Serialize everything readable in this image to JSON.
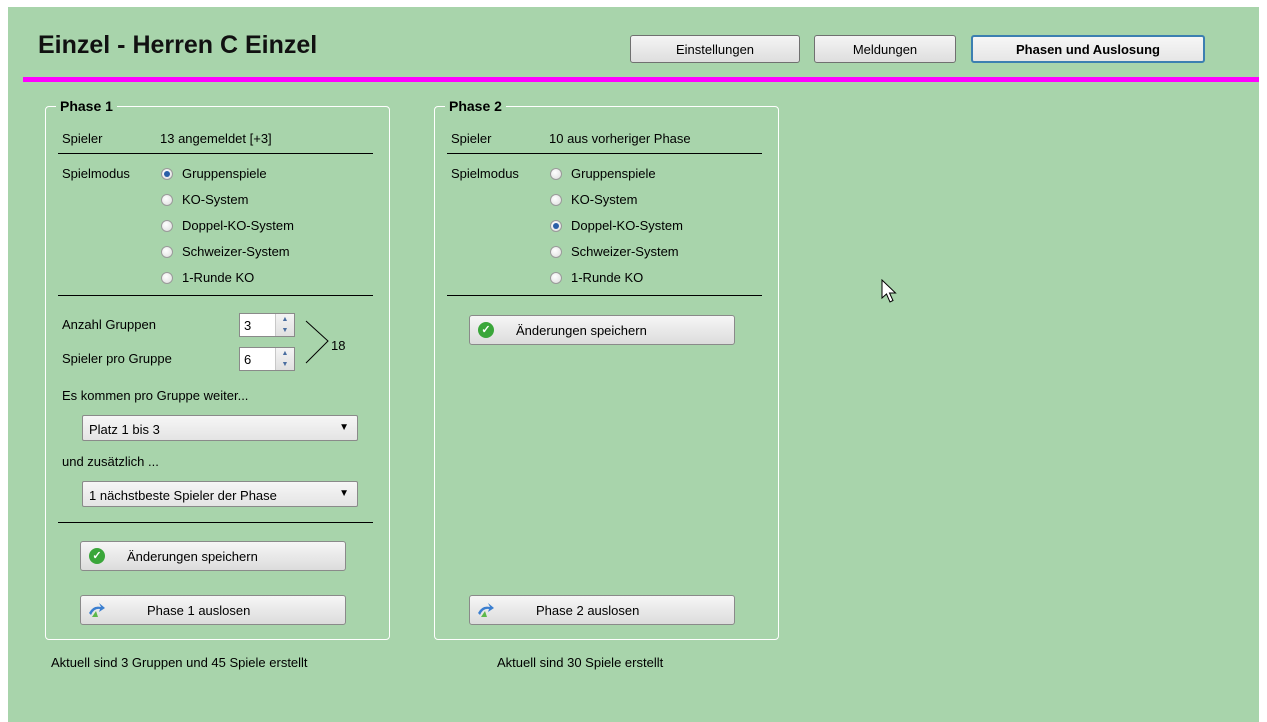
{
  "header": {
    "title": "Einzel - Herren C Einzel",
    "tabs": [
      {
        "label": "Einstellungen"
      },
      {
        "label": "Meldungen"
      },
      {
        "label": "Phasen und Auslosung"
      }
    ],
    "accent_color": "#ff00ff",
    "active_tab_border": "#3c7fb1"
  },
  "background_color": "#a8d4ab",
  "phase1": {
    "title": "Phase 1",
    "players_label": "Spieler",
    "players_value": "13 angemeldet [+3]",
    "mode_label": "Spielmodus",
    "modes": [
      "Gruppenspiele",
      "KO-System",
      "Doppel-KO-System",
      "Schweizer-System",
      "1-Runde KO"
    ],
    "selected_mode": "Gruppenspiele",
    "groups_label": "Anzahl Gruppen",
    "groups_value": "3",
    "per_group_label": "Spieler pro Gruppe",
    "per_group_value": "6",
    "total": "18",
    "advance_label": "Es kommen pro Gruppe weiter...",
    "advance_value": "Platz 1 bis 3",
    "additional_label": "und zusätzlich ...",
    "additional_value": "1 nächstbeste Spieler der Phase",
    "save_button": "Änderungen speichern",
    "draw_button": "Phase 1 auslosen",
    "status": "Aktuell sind 3 Gruppen und 45 Spiele erstellt"
  },
  "phase2": {
    "title": "Phase 2",
    "players_label": "Spieler",
    "players_value": "10 aus vorheriger Phase",
    "mode_label": "Spielmodus",
    "modes": [
      "Gruppenspiele",
      "KO-System",
      "Doppel-KO-System",
      "Schweizer-System",
      "1-Runde KO"
    ],
    "selected_mode": "Doppel-KO-System",
    "save_button": "Änderungen speichern",
    "draw_button": "Phase 2 auslosen",
    "status": "Aktuell sind 30 Spiele erstellt"
  },
  "icons": {
    "save": "check-circle-icon",
    "draw": "shuffle-arrows-icon",
    "dropdown": "chevron-down-icon",
    "cursor": "mouse-pointer-icon"
  }
}
